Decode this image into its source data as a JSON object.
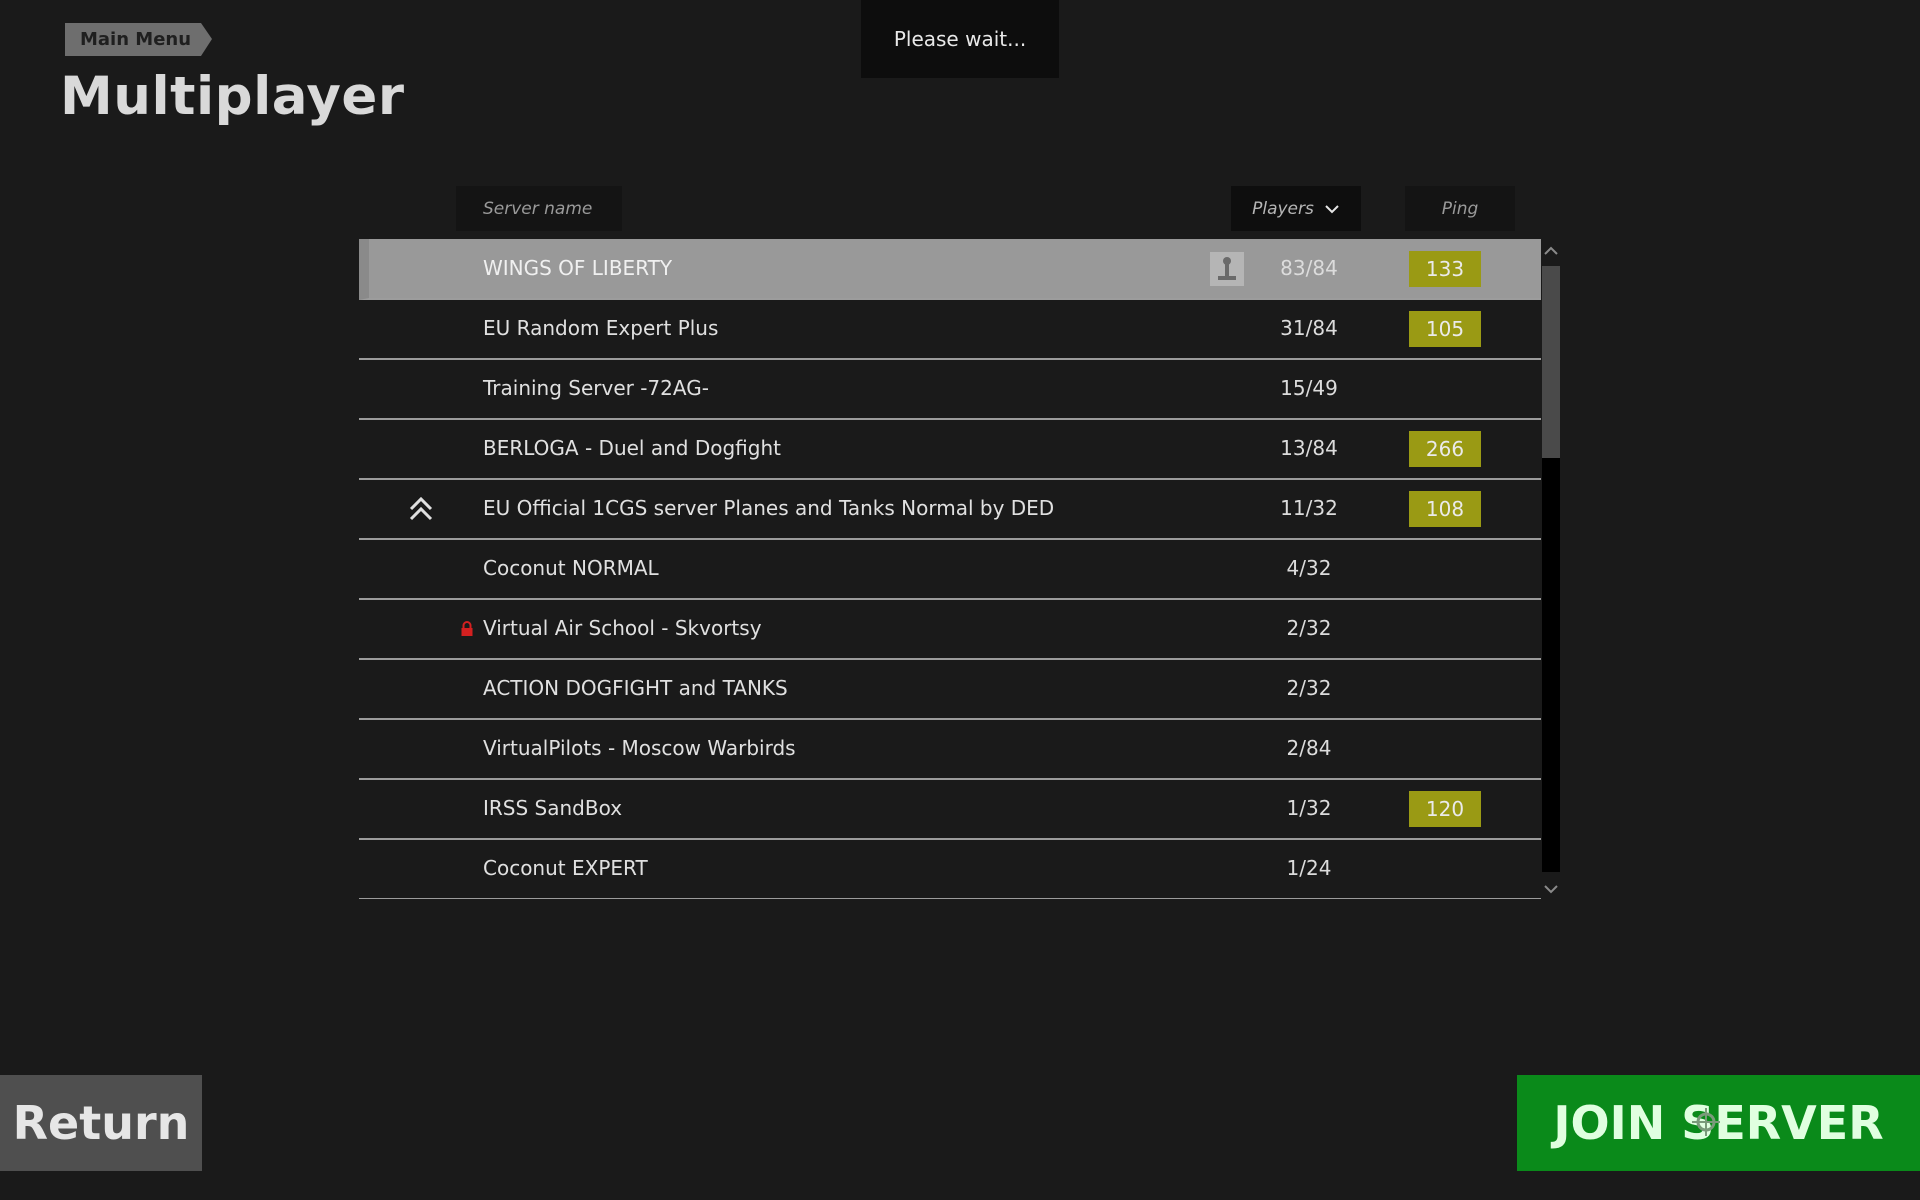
{
  "breadcrumb": {
    "label": "Main Menu"
  },
  "page": {
    "title": "Multiplayer"
  },
  "toast": {
    "text": "Please wait..."
  },
  "columns": {
    "server_name": "Server name",
    "players": "Players",
    "ping": "Ping"
  },
  "servers": [
    {
      "name": "WINGS OF LIBERTY",
      "players": "83/84",
      "ping": "133",
      "selected": true
    },
    {
      "name": "EU Random Expert Plus",
      "players": "31/84",
      "ping": "105"
    },
    {
      "name": "Training Server -72AG-",
      "players": "15/49",
      "ping": ""
    },
    {
      "name": "BERLOGA - Duel and Dogfight",
      "players": "13/84",
      "ping": "266"
    },
    {
      "name": "EU Official 1CGS server Planes and Tanks Normal by DED",
      "players": "11/32",
      "ping": "108",
      "rank_icon": "chevron-double-up-icon"
    },
    {
      "name": "Coconut NORMAL",
      "players": "4/32",
      "ping": ""
    },
    {
      "name": "Virtual Air School - Skvortsy",
      "players": "2/32",
      "ping": "",
      "locked": true
    },
    {
      "name": "ACTION DOGFIGHT and TANKS",
      "players": "2/32",
      "ping": ""
    },
    {
      "name": "VirtualPilots - Moscow Warbirds",
      "players": "2/84",
      "ping": ""
    },
    {
      "name": "IRSS SandBox",
      "players": "1/32",
      "ping": "120"
    },
    {
      "name": "Coconut EXPERT",
      "players": "1/24",
      "ping": ""
    }
  ],
  "buttons": {
    "return": "Return",
    "join": "JOIN SERVER"
  },
  "colors": {
    "ping_badge": "#9a9a14",
    "join": "#0a8a1a",
    "lock": "#d42020"
  }
}
